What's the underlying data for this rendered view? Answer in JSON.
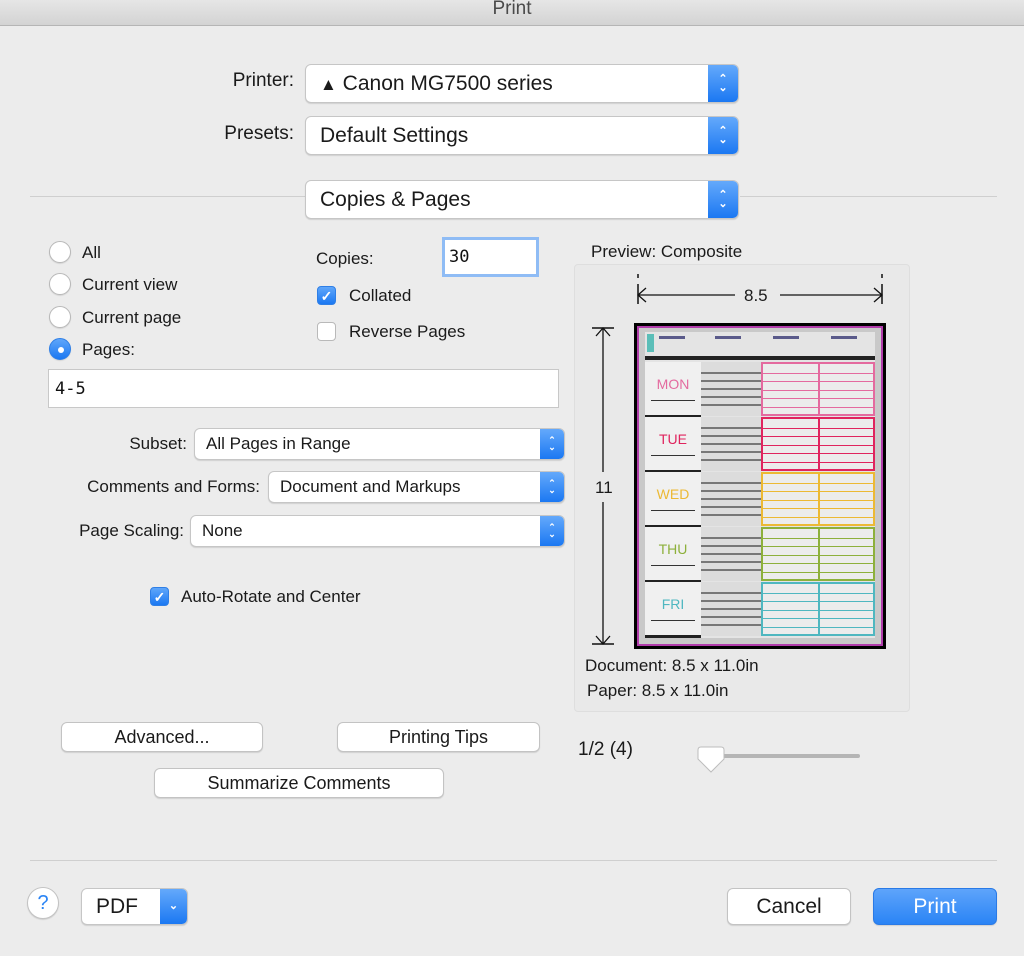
{
  "window": {
    "title": "Print"
  },
  "printer": {
    "label": "Printer:",
    "value": "Canon MG7500 series",
    "warning_icon": "warning-triangle-icon"
  },
  "presets": {
    "label": "Presets:",
    "value": "Default Settings"
  },
  "panel": {
    "value": "Copies & Pages"
  },
  "pages": {
    "options": [
      {
        "label": "All",
        "selected": false
      },
      {
        "label": "Current view",
        "selected": false
      },
      {
        "label": "Current page",
        "selected": false
      },
      {
        "label": "Pages:",
        "selected": true
      }
    ],
    "range_value": "4-5"
  },
  "copies": {
    "label": "Copies:",
    "value": "30"
  },
  "collated": {
    "label": "Collated",
    "checked": true
  },
  "reverse_pages": {
    "label": "Reverse Pages",
    "checked": false
  },
  "subset": {
    "label": "Subset:",
    "value": "All Pages in Range"
  },
  "comments_forms": {
    "label": "Comments and Forms:",
    "value": "Document and Markups"
  },
  "page_scaling": {
    "label": "Page Scaling:",
    "value": "None"
  },
  "auto_rotate": {
    "label": "Auto-Rotate and Center",
    "checked": true
  },
  "buttons": {
    "advanced": "Advanced...",
    "printing_tips": "Printing Tips",
    "summarize_comments": "Summarize Comments",
    "help": "?",
    "pdf": "PDF",
    "cancel": "Cancel",
    "print": "Print"
  },
  "preview": {
    "title": "Preview: Composite",
    "width_label": "8.5",
    "height_label": "11",
    "document_size": "Document: 8.5 x 11.0in",
    "paper_size": "Paper: 8.5 x 11.0in",
    "page_indicator": "1/2 (4)",
    "slider_position": 0,
    "days": [
      {
        "name": "MON",
        "color": "#e46a9f"
      },
      {
        "name": "TUE",
        "color": "#e0245e"
      },
      {
        "name": "WED",
        "color": "#ecb934"
      },
      {
        "name": "THU",
        "color": "#8db03b"
      },
      {
        "name": "FRI",
        "color": "#4fb7c0"
      }
    ]
  },
  "colors": {
    "accent": "#1b78f2",
    "background": "#ececec",
    "print_button": "#2a84f5"
  }
}
